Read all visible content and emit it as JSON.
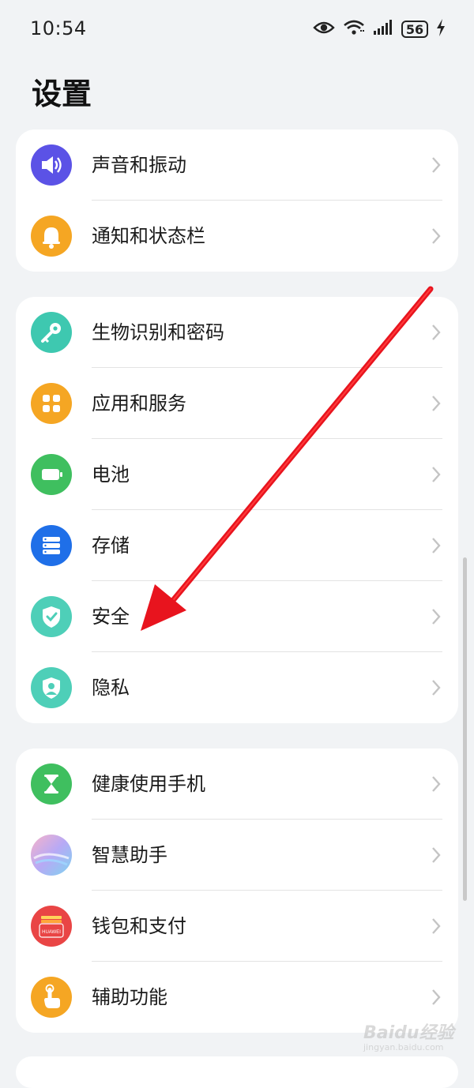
{
  "status_bar": {
    "time": "10:54",
    "battery_level": "56"
  },
  "page_title": "设置",
  "groups": [
    {
      "items": [
        {
          "label": "声音和振动",
          "icon": "speaker-icon",
          "color": "#5b52e6"
        },
        {
          "label": "通知和状态栏",
          "icon": "bell-icon",
          "color": "#f5a623"
        }
      ]
    },
    {
      "items": [
        {
          "label": "生物识别和密码",
          "icon": "key-icon",
          "color": "#3ec8b0"
        },
        {
          "label": "应用和服务",
          "icon": "apps-grid-icon",
          "color": "#f5a623"
        },
        {
          "label": "电池",
          "icon": "battery-icon",
          "color": "#3fbf5f"
        },
        {
          "label": "存储",
          "icon": "storage-icon",
          "color": "#1f6fe8"
        },
        {
          "label": "安全",
          "icon": "shield-check-icon",
          "color": "#4ecfb8"
        },
        {
          "label": "隐私",
          "icon": "shield-person-icon",
          "color": "#4ecfb8"
        }
      ]
    },
    {
      "items": [
        {
          "label": "健康使用手机",
          "icon": "hourglass-icon",
          "color": "#3fbf5f"
        },
        {
          "label": "智慧助手",
          "icon": "assistant-orb-icon",
          "color": "#b7a9f5"
        },
        {
          "label": "钱包和支付",
          "icon": "wallet-icon",
          "color": "#e94545"
        },
        {
          "label": "辅助功能",
          "icon": "hand-touch-icon",
          "color": "#f5a623"
        }
      ]
    }
  ],
  "wallet_icon_text": "HUAWEI",
  "watermark": {
    "brand": "Baidu经验",
    "url": "jingyan.baidu.com"
  }
}
